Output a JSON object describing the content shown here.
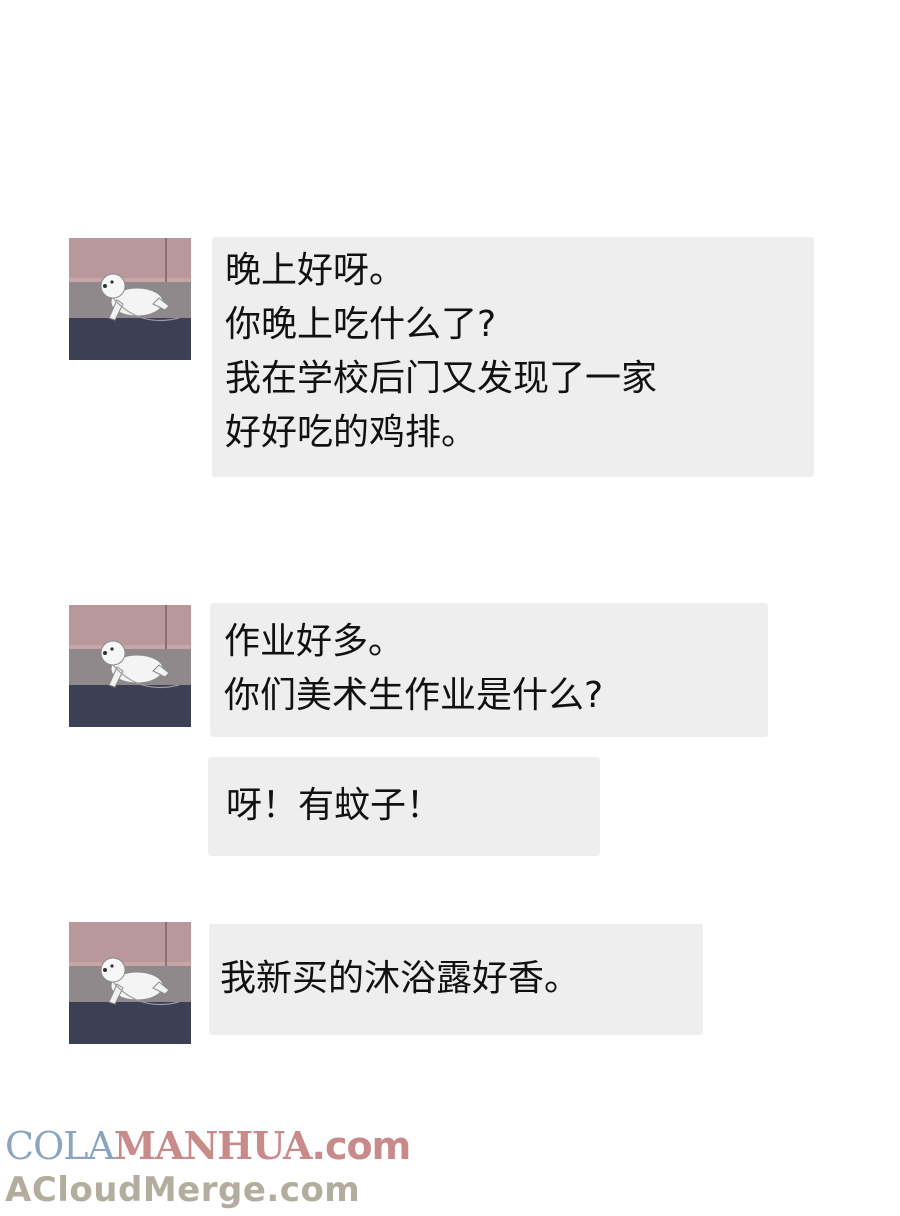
{
  "messages": [
    {
      "lines": [
        "晚上好呀。",
        "你晚上吃什么了?",
        "我在学校后门又发现了一家",
        "好好吃的鸡排。"
      ]
    },
    {
      "lines": [
        "作业好多。",
        "你们美术生作业是什么?"
      ]
    },
    {
      "lines": [
        "呀！有蚊子！"
      ]
    },
    {
      "lines": [
        "我新买的沐浴露好香。"
      ]
    }
  ],
  "avatar": {
    "icon": "white-dog-avatar-icon"
  },
  "watermark": {
    "line1_part1": "COLA",
    "line1_part2": "MANHUA",
    "line1_part3": ".com",
    "line2": "ACloudMerge.com"
  },
  "colors": {
    "bubble_bg": "#eeeeef",
    "text": "#111111",
    "watermark_blue": "#8aa6bf",
    "watermark_pink": "#c98a8a",
    "watermark_tan": "#b3ad9e"
  }
}
